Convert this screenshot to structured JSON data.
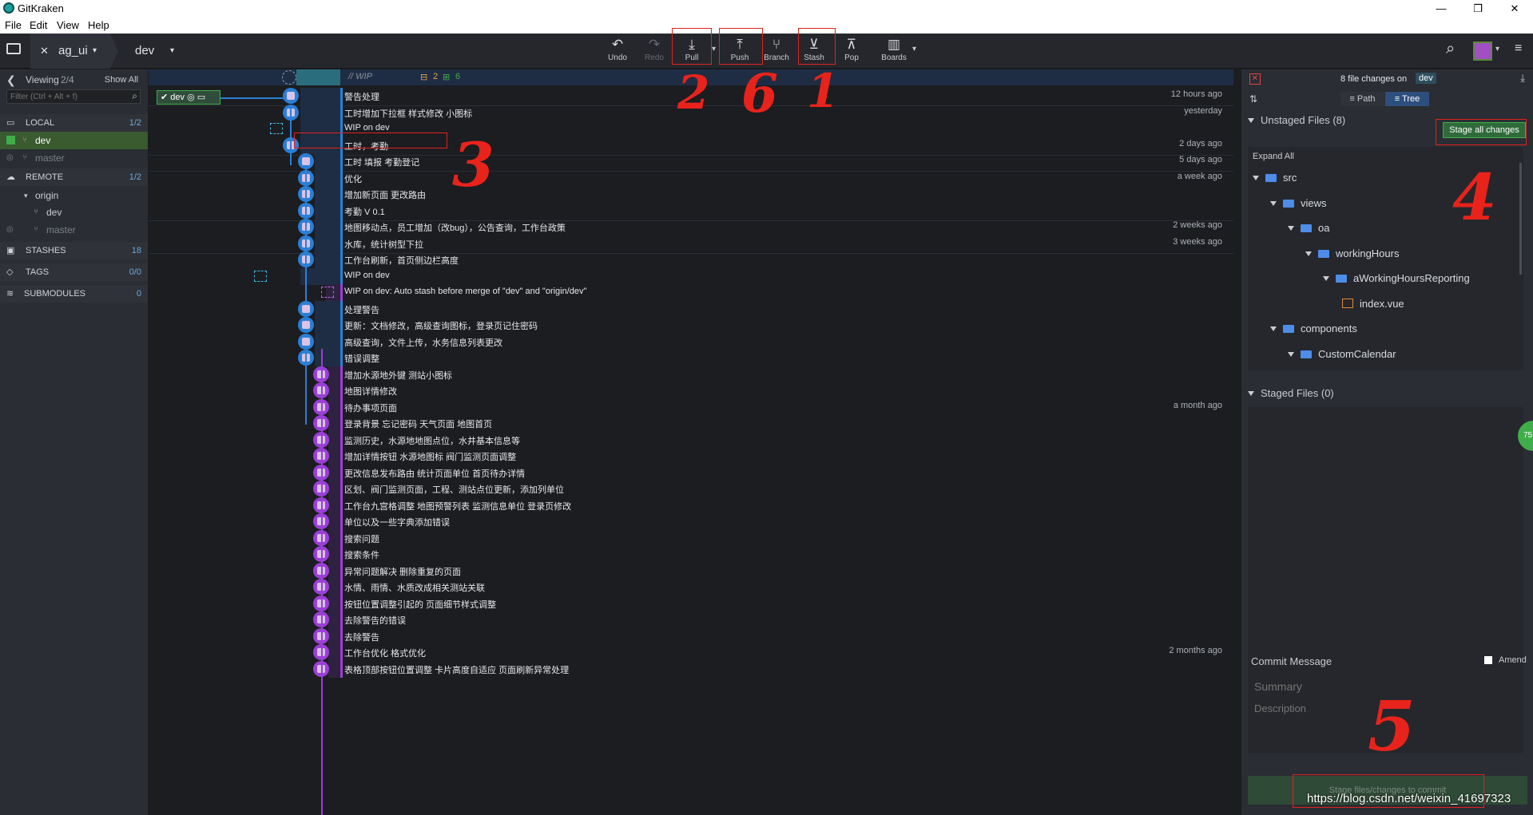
{
  "window": {
    "title": "GitKraken"
  },
  "menu": [
    "File",
    "Edit",
    "View",
    "Help"
  ],
  "toolbar": {
    "repo": "ag_ui",
    "branch": "dev",
    "buttons": {
      "undo": "Undo",
      "redo": "Redo",
      "pull": "Pull",
      "push": "Push",
      "branch": "Branch",
      "stash": "Stash",
      "pop": "Pop",
      "boards": "Boards"
    }
  },
  "left": {
    "viewing_label": "Viewing",
    "viewing_count": "2/4",
    "show_all": "Show All",
    "filter_placeholder": "Filter (Ctrl + Alt + f)",
    "local": {
      "label": "LOCAL",
      "count": "1/2",
      "branches": [
        "dev",
        "master"
      ]
    },
    "remote": {
      "label": "REMOTE",
      "count": "1/2",
      "origin": "origin",
      "branches": [
        "dev",
        "master"
      ]
    },
    "stashes": {
      "label": "STASHES",
      "count": "18"
    },
    "tags": {
      "label": "TAGS",
      "count": "0/0"
    },
    "submodules": {
      "label": "SUBMODULES",
      "count": "0"
    }
  },
  "graph": {
    "wip_label": "// WIP",
    "wip_edit_count": "2",
    "wip_add_count": "6",
    "branch_tag": "dev",
    "commits": [
      {
        "msg": "警告处理",
        "time": "12 hours ago"
      },
      {
        "msg": "工时增加下拉框 样式修改 小图标",
        "time": "yesterday"
      },
      {
        "msg": "WIP on dev",
        "time": ""
      },
      {
        "msg": "工时，考勤",
        "time": "2 days ago"
      },
      {
        "msg": "工时 填报 考勤登记",
        "time": "5 days ago"
      },
      {
        "msg": "优化",
        "time": "a week ago"
      },
      {
        "msg": "增加新页面 更改路由",
        "time": ""
      },
      {
        "msg": "考勤 V 0.1",
        "time": ""
      },
      {
        "msg": "地图移动点，员工增加（改bug），公告查询，工作台政策",
        "time": "2 weeks ago"
      },
      {
        "msg": "水库，统计树型下拉",
        "time": "3 weeks ago"
      },
      {
        "msg": "工作台刷新，首页侧边栏高度",
        "time": ""
      },
      {
        "msg": "WIP on dev",
        "time": ""
      },
      {
        "msg": "WIP on dev: Auto stash before merge of \"dev\" and \"origin/dev\"",
        "time": ""
      },
      {
        "msg": "处理警告",
        "time": ""
      },
      {
        "msg": "更新：文档修改，高级查询图标，登录页记住密码",
        "time": ""
      },
      {
        "msg": "高级查询，文件上传，水务信息列表更改",
        "time": ""
      },
      {
        "msg": "错误调整",
        "time": ""
      },
      {
        "msg": "增加水源地外键 测站小图标",
        "time": ""
      },
      {
        "msg": "地图详情修改",
        "time": ""
      },
      {
        "msg": "待办事项页面",
        "time": "a month ago"
      },
      {
        "msg": "登录背景 忘记密码 天气页面 地图首页",
        "time": ""
      },
      {
        "msg": "监测历史，水源地地图点位，水井基本信息等",
        "time": ""
      },
      {
        "msg": "增加详情按钮 水源地图标 阀门监测页面调整",
        "time": ""
      },
      {
        "msg": "更改信息发布路由 统计页面单位 首页待办详情",
        "time": ""
      },
      {
        "msg": "区划、阀门监测页面，工程、测站点位更新，添加列单位",
        "time": ""
      },
      {
        "msg": "工作台九宫格调整 地图预警列表 监测信息单位 登录页修改",
        "time": ""
      },
      {
        "msg": "单位以及一些字典添加错误",
        "time": ""
      },
      {
        "msg": "搜索问题",
        "time": ""
      },
      {
        "msg": "搜索条件",
        "time": ""
      },
      {
        "msg": "异常问题解决 删除重复的页面",
        "time": ""
      },
      {
        "msg": "水情、雨情、水质改成相关测站关联",
        "time": ""
      },
      {
        "msg": "按钮位置调整引起的 页面细节样式调整",
        "time": ""
      },
      {
        "msg": "去除警告的错误",
        "time": ""
      },
      {
        "msg": "去除警告",
        "time": ""
      },
      {
        "msg": "工作台优化 格式优化",
        "time": "2 months ago"
      },
      {
        "msg": "表格顶部按钮位置调整 卡片高度自适应 页面刷新异常处理",
        "time": ""
      }
    ]
  },
  "right": {
    "changes_text": "8 file changes on",
    "branch": "dev",
    "view_path": "Path",
    "view_tree": "Tree",
    "unstaged_label": "Unstaged Files (8)",
    "stage_all": "Stage all changes",
    "expand_all": "Expand All",
    "tree": [
      "src",
      "views",
      "oa",
      "workingHours",
      "aWorkingHoursReporting",
      "index.vue",
      "components",
      "CustomCalendar"
    ],
    "staged_label": "Staged Files (0)",
    "commit_message": "Commit Message",
    "amend": "Amend",
    "summary_placeholder": "Summary",
    "description_placeholder": "Description",
    "commit_button": "Stage files/changes to commit",
    "badge": "75"
  },
  "annotations": [
    "2",
    "6",
    "1",
    "3",
    "4",
    "5"
  ],
  "watermark": "https://blog.csdn.net/weixin_41697323",
  "colors": {
    "accent_blue": "#2a7fd6",
    "purple": "#9b3fd6",
    "red": "#e0231c",
    "green": "#3fae4a"
  }
}
